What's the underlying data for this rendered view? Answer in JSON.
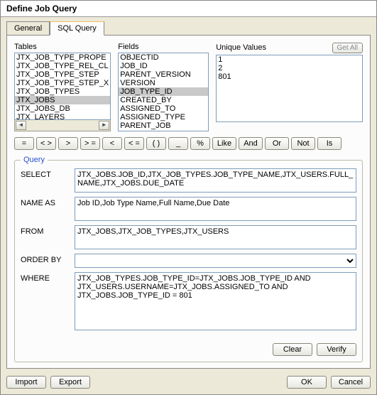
{
  "window": {
    "title": "Define Job Query"
  },
  "tabs": {
    "general": "General",
    "sql_query": "SQL Query"
  },
  "lists": {
    "tables_label": "Tables",
    "fields_label": "Fields",
    "values_label": "Unique Values",
    "get_all": "Get All",
    "tables": [
      "JTX_JOB_TYPE_PROPE",
      "JTX_JOB_TYPE_REL_CL",
      "JTX_JOB_TYPE_STEP",
      "JTX_JOB_TYPE_STEP_X",
      "JTX_JOB_TYPES",
      "JTX_JOBS",
      "JTX_JOBS_DB",
      "JTX_LAYERS"
    ],
    "tables_selected": "JTX_JOBS",
    "fields": [
      "OBJECTID",
      "JOB_ID",
      "PARENT_VERSION",
      "VERSION",
      "JOB_TYPE_ID",
      "CREATED_BY",
      "ASSIGNED_TO",
      "ASSIGNED_TYPE",
      "PARENT_JOB"
    ],
    "fields_selected": "JOB_TYPE_ID",
    "unique_values": [
      "1",
      "2",
      "801"
    ]
  },
  "ops": {
    "eq": "=",
    "ne": "< >",
    "gt": ">",
    "ge": "> =",
    "lt": "<",
    "le": "< =",
    "paren": "( )",
    "under": "_",
    "pct": "%",
    "like": "Like",
    "and": "And",
    "or": "Or",
    "not": "Not",
    "is": "Is"
  },
  "query": {
    "legend": "Query",
    "select_label": "SELECT",
    "select": "JTX_JOBS.JOB_ID,JTX_JOB_TYPES.JOB_TYPE_NAME,JTX_USERS.FULL_NAME,JTX_JOBS.DUE_DATE",
    "nameas_label": "NAME AS",
    "nameas": "Job ID,Job Type Name,Full Name,Due Date",
    "from_label": "FROM",
    "from": "JTX_JOBS,JTX_JOB_TYPES,JTX_USERS",
    "orderby_label": "ORDER BY",
    "orderby": "",
    "where_label": "WHERE",
    "where": "JTX_JOB_TYPES.JOB_TYPE_ID=JTX_JOBS.JOB_TYPE_ID AND JTX_USERS.USERNAME=JTX_JOBS.ASSIGNED_TO AND JTX_JOBS.JOB_TYPE_ID = 801",
    "clear": "Clear",
    "verify": "Verify"
  },
  "buttons": {
    "import": "Import",
    "export": "Export",
    "ok": "OK",
    "cancel": "Cancel"
  }
}
